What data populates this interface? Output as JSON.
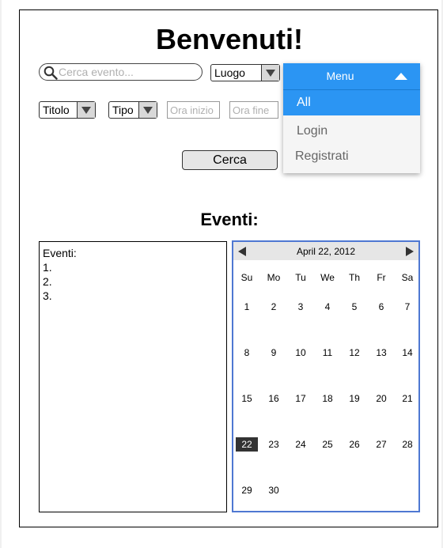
{
  "header": {
    "title": "Benvenuti!"
  },
  "search": {
    "placeholder": "Cerca evento..."
  },
  "filters": {
    "luogo": "Luogo",
    "titolo": "Titolo",
    "tipo": "Tipo",
    "ora_inizio_placeholder": "Ora inizio",
    "ora_fine_placeholder": "Ora fine"
  },
  "actions": {
    "search_label": "Cerca"
  },
  "menu": {
    "label": "Menu",
    "items": [
      {
        "label": "All",
        "selected": true
      },
      {
        "label": "Login"
      },
      {
        "label": "Registrati"
      }
    ]
  },
  "events": {
    "heading": "Eventi:",
    "list_title": "Eventi:",
    "items": [
      "1.",
      "2.",
      "3."
    ]
  },
  "calendar": {
    "month_label": "April 22, 2012",
    "weekdays": [
      "Su",
      "Mo",
      "Tu",
      "We",
      "Th",
      "Fr",
      "Sa"
    ],
    "weeks": [
      [
        "1",
        "2",
        "3",
        "4",
        "5",
        "6",
        "7"
      ],
      [
        "8",
        "9",
        "10",
        "11",
        "12",
        "13",
        "14"
      ],
      [
        "15",
        "16",
        "17",
        "18",
        "19",
        "20",
        "21"
      ],
      [
        "22",
        "23",
        "24",
        "25",
        "26",
        "27",
        "28"
      ],
      [
        "29",
        "30",
        "",
        "",
        "",
        "",
        ""
      ]
    ],
    "selected_day": "22"
  }
}
